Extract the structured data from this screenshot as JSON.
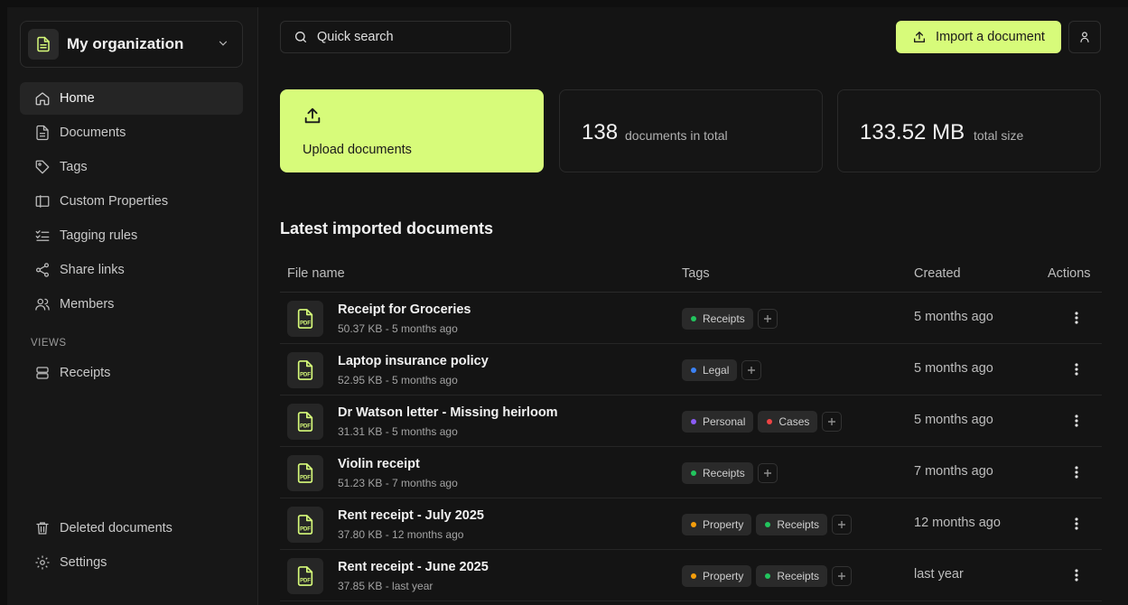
{
  "org": {
    "name": "My organization"
  },
  "nav": {
    "items": [
      {
        "label": "Home",
        "icon": "home-icon",
        "active": true
      },
      {
        "label": "Documents",
        "icon": "document-icon"
      },
      {
        "label": "Tags",
        "icon": "tag-icon"
      },
      {
        "label": "Custom Properties",
        "icon": "custom-properties-icon"
      },
      {
        "label": "Tagging rules",
        "icon": "list-check-icon"
      },
      {
        "label": "Share links",
        "icon": "share-icon"
      },
      {
        "label": "Members",
        "icon": "users-icon"
      }
    ],
    "views_heading": "VIEWS",
    "views": [
      {
        "label": "Receipts",
        "icon": "database-icon"
      }
    ],
    "bottom": [
      {
        "label": "Deleted documents",
        "icon": "trash-icon"
      },
      {
        "label": "Settings",
        "icon": "settings-icon"
      }
    ]
  },
  "header": {
    "search_label": "Quick search",
    "import_label": "Import a document"
  },
  "cards": {
    "upload_label": "Upload documents",
    "total_docs_value": "138",
    "total_docs_label": "documents in total",
    "total_size_value": "133.52 MB",
    "total_size_label": "total size"
  },
  "table": {
    "title": "Latest imported documents",
    "columns": {
      "file": "File name",
      "tags": "Tags",
      "created": "Created",
      "actions": "Actions"
    },
    "rows": [
      {
        "name": "Receipt for Groceries",
        "meta": "50.37 KB - 5 months ago",
        "created": "5 months ago",
        "tags": [
          {
            "label": "Receipts",
            "color": "#22c55e"
          }
        ]
      },
      {
        "name": "Laptop insurance policy",
        "meta": "52.95 KB - 5 months ago",
        "created": "5 months ago",
        "tags": [
          {
            "label": "Legal",
            "color": "#3b82f6"
          }
        ]
      },
      {
        "name": "Dr Watson letter - Missing heirloom",
        "meta": "31.31 KB - 5 months ago",
        "created": "5 months ago",
        "tags": [
          {
            "label": "Personal",
            "color": "#8b5cf6"
          },
          {
            "label": "Cases",
            "color": "#ef4444"
          }
        ]
      },
      {
        "name": "Violin receipt",
        "meta": "51.23 KB - 7 months ago",
        "created": "7 months ago",
        "tags": [
          {
            "label": "Receipts",
            "color": "#22c55e"
          }
        ]
      },
      {
        "name": "Rent receipt - July 2025",
        "meta": "37.80 KB - 12 months ago",
        "created": "12 months ago",
        "tags": [
          {
            "label": "Property",
            "color": "#f59e0b"
          },
          {
            "label": "Receipts",
            "color": "#22c55e"
          }
        ]
      },
      {
        "name": "Rent receipt - June 2025",
        "meta": "37.85 KB - last year",
        "created": "last year",
        "tags": [
          {
            "label": "Property",
            "color": "#f59e0b"
          },
          {
            "label": "Receipts",
            "color": "#22c55e"
          }
        ]
      }
    ]
  },
  "colors": {
    "accent": "#d7fb7a",
    "background": "#141414",
    "sidebar": "#171717"
  }
}
